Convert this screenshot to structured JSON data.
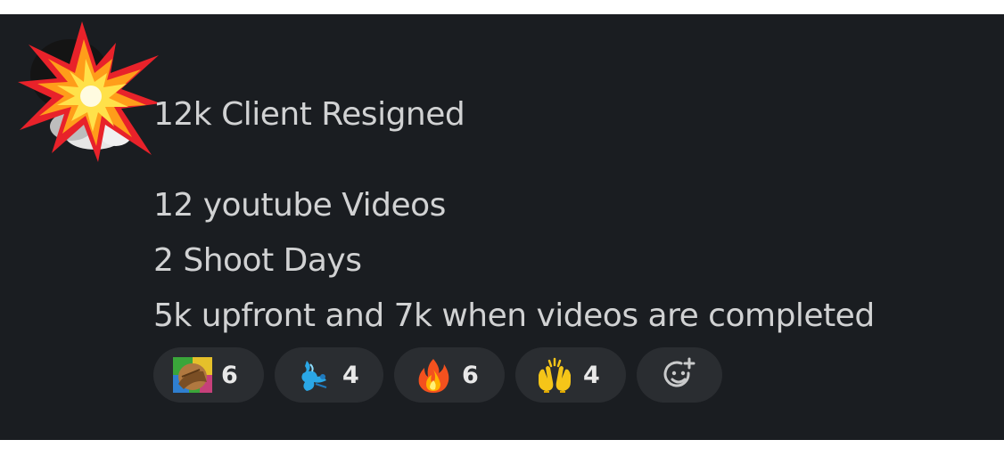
{
  "message": {
    "title": "12k Client Resigned",
    "lines": [
      "12 youtube Videos",
      "2 Shoot Days",
      "5k upfront and 7k when videos are completed"
    ]
  },
  "reactions": [
    {
      "icon": "facepalm-emoji-icon",
      "count": "6"
    },
    {
      "icon": "blue-water-emoji-icon",
      "count": "4"
    },
    {
      "icon": "fire-emoji-icon",
      "count": "6"
    },
    {
      "icon": "raised-hands-emoji-icon",
      "count": "4"
    }
  ],
  "add_reaction": {
    "icon": "add-reaction-icon"
  },
  "avatar": {
    "icon": "collision-burst-icon"
  }
}
